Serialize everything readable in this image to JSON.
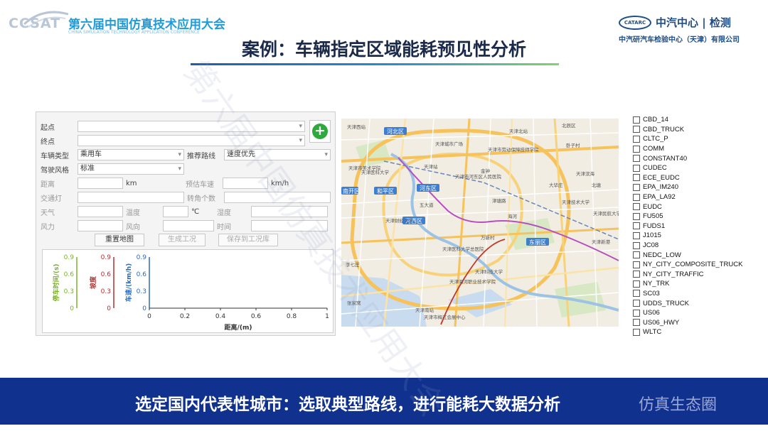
{
  "header": {
    "logo_left_text": "CCSAT",
    "conference_title": "第六届中国仿真技术应用大会",
    "conference_subtitle": "CHINA SIMULATION TECHNOLOGY APPLICATION CONFERENCE",
    "logo_right_mark": "CATARC",
    "brand_name": "中汽中心 | 检测",
    "brand_sub": "中汽研汽车检验中心（天津）有限公司",
    "page_title": "案例：车辆指定区域能耗预见性分析"
  },
  "form": {
    "start_label": "起点",
    "end_label": "终点",
    "vehicle_type_label": "车辆类型",
    "vehicle_type_value": "乘用车",
    "route_label": "推荐路线",
    "route_value": "速度优先",
    "driving_style_label": "驾驶风格",
    "driving_style_value": "标准",
    "distance_label": "距离",
    "distance_unit": "km",
    "est_speed_label": "预估车速",
    "speed_unit": "km/h",
    "traffic_light_label": "交通灯",
    "turn_count_label": "转角个数",
    "weather_label": "天气",
    "temperature_label": "温度",
    "temperature_unit": "℃",
    "humidity_label": "湿度",
    "wind_force_label": "风力",
    "wind_dir_label": "风向",
    "time_label": "时间"
  },
  "buttons": {
    "reset_map": "重置地图",
    "generate": "生成工况",
    "save": "保存到工况库"
  },
  "chart_data": {
    "type": "line",
    "series": [],
    "x_ticks": [
      "0",
      "0.2",
      "0.4",
      "0.6",
      "0.8",
      "1"
    ],
    "y_ticks": [
      "0",
      "0.3",
      "0.6",
      "0.9"
    ],
    "xlabel": "距离/(m)",
    "ylabels": [
      {
        "text": "停车时间/(s)",
        "color": "#7bb02a"
      },
      {
        "text": "坡度",
        "color": "#b33030"
      },
      {
        "text": "车速/(km/h)",
        "color": "#2f69b8"
      }
    ],
    "xlim": [
      0,
      1
    ],
    "ylim": [
      0,
      0.9
    ]
  },
  "map": {
    "labels": [
      "天津西站",
      "河北区",
      "天津城市广场",
      "北辰区",
      "天津市劳动保障技师学院",
      "金钟",
      "卧子村",
      "天津站",
      "天津北站",
      "北塘",
      "天津医科大学",
      "和平区",
      "天津市河东区人民医院",
      "天津滨海",
      "天津市美术学院",
      "河东区",
      "万新村",
      "东丽区",
      "天津技术大学",
      "天津民航大学",
      "南开区",
      "五大道",
      "河西区",
      "天津医科大学总医院",
      "天津财经大学",
      "天津科技大学",
      "天津海河职业技术学院",
      "天津新港",
      "李七庄",
      "天津南站",
      "天津市梅江会展中心",
      "津塘路",
      "大毕庄",
      "海河",
      "张家窝"
    ]
  },
  "cycles": [
    "CBD_14",
    "CBD_TRUCK",
    "CLTC_P",
    "COMM",
    "CONSTANT40",
    "CUDEC",
    "ECE_EUDC",
    "EPA_IM240",
    "EPA_LA92",
    "EUDC",
    "FU505",
    "FUDS1",
    "J1015",
    "JC08",
    "NEDC_LOW",
    "NY_CITY_COMPOSITE_TRUCK",
    "NY_CITY_TRAFFIC",
    "NY_TRK",
    "SC03",
    "UDDS_TRUCK",
    "US06",
    "US06_HWY",
    "WLTC"
  ],
  "banner": {
    "text": "选定国内代表性城市：选取典型路线，进行能耗大数据分析",
    "watermark": "仿真生态圈"
  }
}
